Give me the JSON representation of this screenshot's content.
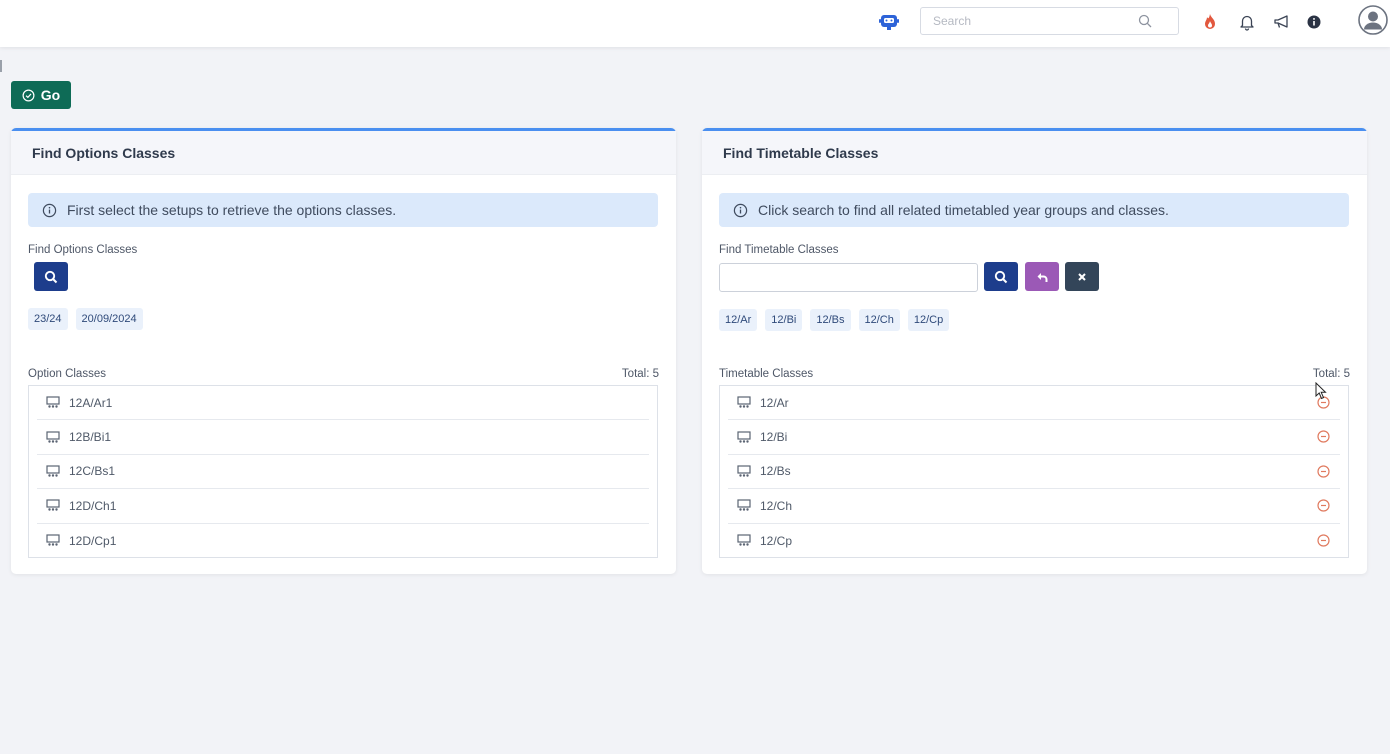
{
  "topbar": {
    "search_placeholder": "Search"
  },
  "actions": {
    "go_label": "Go"
  },
  "options_panel": {
    "title": "Find Options Classes",
    "info": "First select the setups to retrieve the options classes.",
    "field_label": "Find Options Classes",
    "chips": [
      "23/24",
      "20/09/2024"
    ],
    "list_label": "Option Classes",
    "total": "Total: 5",
    "items": [
      "12A/Ar1",
      "12B/Bi1",
      "12C/Bs1",
      "12D/Ch1",
      "12D/Cp1"
    ]
  },
  "timetable_panel": {
    "title": "Find Timetable Classes",
    "info": "Click search to find all related timetabled year groups and classes.",
    "field_label": "Find Timetable Classes",
    "input_value": "",
    "chips": [
      "12/Ar",
      "12/Bi",
      "12/Bs",
      "12/Ch",
      "12/Cp"
    ],
    "list_label": "Timetable Classes",
    "total": "Total: 5",
    "items": [
      "12/Ar",
      "12/Bi",
      "12/Bs",
      "12/Ch",
      "12/Cp"
    ]
  },
  "colors": {
    "go_button": "#0e6b56",
    "card_accent": "#4a8ff0",
    "search_button": "#1d3d8c",
    "undo_button": "#9b59b6",
    "clear_button": "#334559",
    "remove_icon": "#e07a5f",
    "info_banner": "#dbe9fb"
  },
  "icons": {
    "bot": "chatbot-icon",
    "search": "search-icon",
    "fire": "fire-icon",
    "bell": "bell-icon",
    "announce": "megaphone-icon",
    "info": "info-icon",
    "avatar": "user-avatar-icon",
    "go": "check-circle-icon",
    "class": "classroom-icon",
    "remove": "minus-circle-icon",
    "undo": "undo-icon",
    "clear": "close-icon"
  }
}
